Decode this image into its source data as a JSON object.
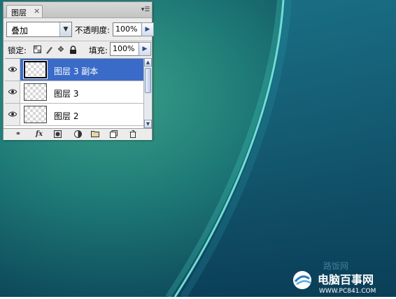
{
  "panel": {
    "tab_label": "图层",
    "tab_close": "×",
    "menu_icon": "panel-menu-icon",
    "blend_mode": "叠加",
    "opacity_label": "不透明度:",
    "opacity_value": "100%",
    "lock_label": "锁定:",
    "fill_label": "填充:",
    "fill_value": "100%",
    "lock_icons": [
      "lock-transparent-icon",
      "lock-brush-icon",
      "lock-move-icon",
      "lock-all-icon"
    ],
    "layers": [
      {
        "name": "图层 3 副本",
        "selected": true,
        "visible": true
      },
      {
        "name": "图层 3",
        "selected": false,
        "visible": true
      },
      {
        "name": "图层 2",
        "selected": false,
        "visible": true
      }
    ],
    "bottom_icons": [
      "link-icon",
      "fx-icon",
      "mask-icon",
      "adjustment-icon",
      "group-icon",
      "new-layer-icon",
      "trash-icon"
    ],
    "fx_label": "fx"
  },
  "watermark": {
    "brand": "电脑百事网",
    "url": "WWW.PC841.COM",
    "faded_text": "路饭网"
  },
  "colors": {
    "selection": "#3a6bc8",
    "background_dark": "#0e4a5c",
    "background_light": "#2a8a78"
  }
}
